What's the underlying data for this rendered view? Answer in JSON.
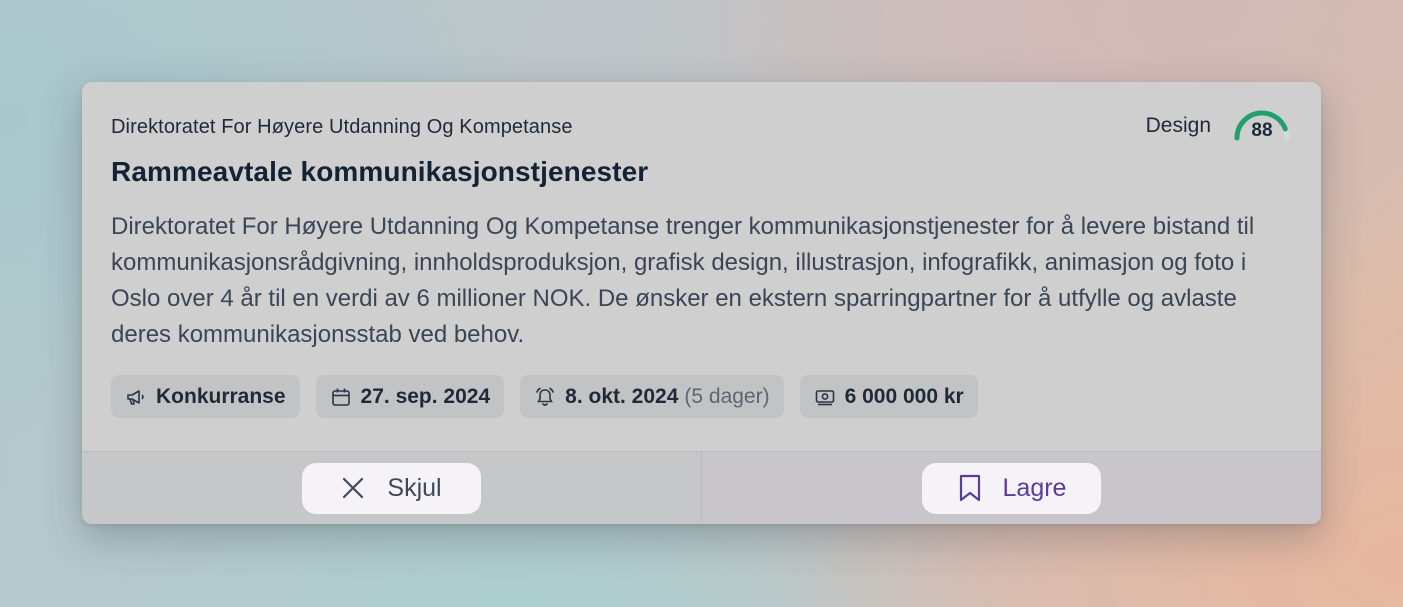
{
  "card": {
    "organization": "Direktoratet For Høyere Utdanning Og Kompetanse",
    "category": "Design",
    "score": {
      "value": "88",
      "fraction": 0.88,
      "color": "#21a06b"
    },
    "title": "Rammeavtale kommunikasjonstjenester",
    "description": "Direktoratet For Høyere Utdanning Og Kompetanse trenger kommunikasjonstjenester for å levere bistand til kommunikasjonsrådgivning, innholdsproduksjon, grafisk design, illustrasjon, infografikk, animasjon og foto i Oslo over 4 år til en verdi av 6 millioner NOK. De ønsker en ekstern sparringpartner for å utfylle og avlaste deres kommunikasjonsstab ved behov.",
    "chips": [
      {
        "icon": "megaphone-icon",
        "label": "Konkurranse"
      },
      {
        "icon": "calendar-icon",
        "label": "27. sep. 2024"
      },
      {
        "icon": "alarm-icon",
        "label": "8. okt. 2024",
        "sub": "(5 dager)"
      },
      {
        "icon": "money-icon",
        "label": "6 000 000 kr"
      }
    ],
    "actions": {
      "hide": {
        "icon": "close-icon",
        "label": "Skjul"
      },
      "save": {
        "icon": "bookmark-icon",
        "label": "Lagre",
        "color": "#5b3c98"
      }
    }
  }
}
